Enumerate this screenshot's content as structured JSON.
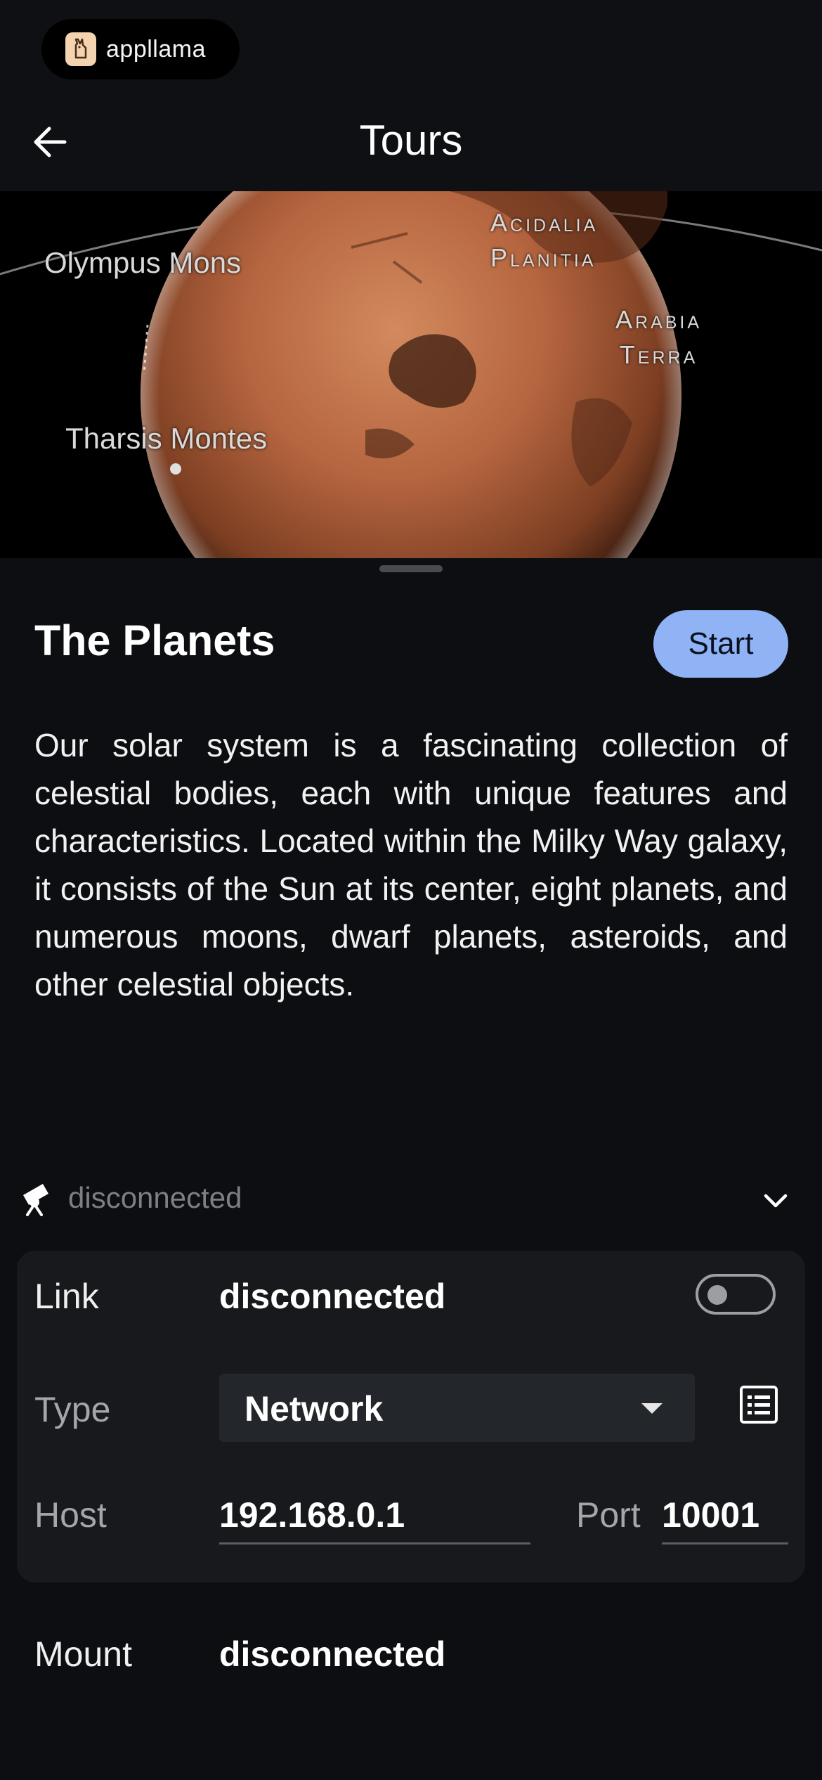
{
  "brand": {
    "name": "appllama",
    "logo_icon": "llama-icon"
  },
  "header": {
    "title": "Tours",
    "back_icon": "arrow-left-icon"
  },
  "hero": {
    "labels": {
      "olympus": "Olympus Mons",
      "tharsis": "Tharsis Montes",
      "acidalia_1": "Acidalia",
      "acidalia_2": "Planitia",
      "arabia_1": "Arabia",
      "arabia_2": "Terra"
    }
  },
  "tour": {
    "title": "The Planets",
    "start_label": "Start",
    "description": "Our solar system is a fascinating collection of celestial bodies, each with unique features and characteristics. Located within the Milky Way galaxy, it consists of the Sun at its center, eight planets, and numerous moons, dwarf planets, asteroids, and other celestial objects."
  },
  "telescope": {
    "status": "disconnected",
    "icon": "telescope-icon",
    "expand_icon": "chevron-down-icon"
  },
  "connection": {
    "link_label": "Link",
    "link_value": "disconnected",
    "link_toggle_on": false,
    "type_label": "Type",
    "type_value": "Network",
    "host_label": "Host",
    "host_value": "192.168.0.1",
    "port_label": "Port",
    "port_value": "10001"
  },
  "mount": {
    "label": "Mount",
    "value": "disconnected"
  },
  "colors": {
    "accent": "#8fb3f4",
    "background": "#0a0b0d",
    "panel": "#17191c",
    "mars": "#b5653f"
  }
}
